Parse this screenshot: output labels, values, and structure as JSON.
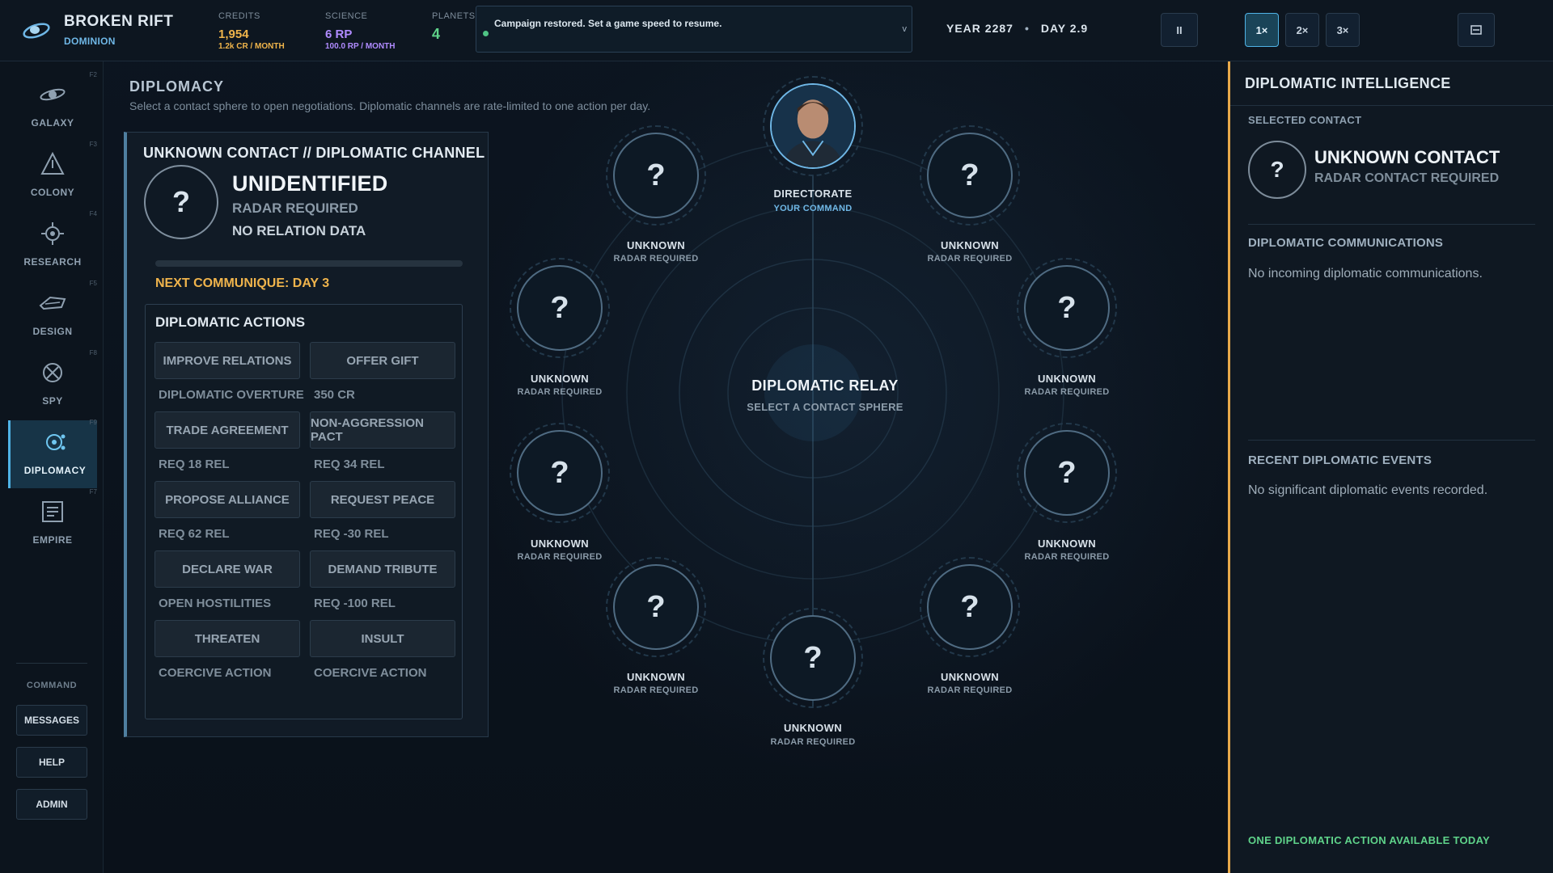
{
  "app": {
    "title": "BROKEN RIFT",
    "faction": "DOMINION"
  },
  "resources": {
    "credits": {
      "label": "CREDITS",
      "value": "1,954",
      "rate": "1.2k CR / MONTH"
    },
    "science": {
      "label": "SCIENCE",
      "value": "6 RP",
      "rate": "100.0 RP / MONTH"
    },
    "planets": {
      "label": "PLANETS",
      "value": "4"
    }
  },
  "notification": {
    "text": "Campaign restored. Set a game speed to resume.",
    "chevron": "v"
  },
  "date": {
    "year": "YEAR 2287",
    "separator": "•",
    "day": "DAY 2.9"
  },
  "controls": {
    "pause": "II",
    "speed1": "1×",
    "speed2": "2×",
    "speed3": "3×",
    "menu_icon": "menu-icon"
  },
  "sidebar": {
    "items": [
      {
        "label": "GALAXY",
        "key": "F2"
      },
      {
        "label": "COLONY",
        "key": "F3"
      },
      {
        "label": "RESEARCH",
        "key": "F4"
      },
      {
        "label": "DESIGN",
        "key": "F5"
      },
      {
        "label": "SPY",
        "key": "F8"
      },
      {
        "label": "DIPLOMACY",
        "key": "F9"
      },
      {
        "label": "EMPIRE",
        "key": "F7"
      }
    ],
    "command_label": "COMMAND",
    "buttons": [
      "MESSAGES",
      "HELP",
      "ADMIN"
    ]
  },
  "main": {
    "title": "DIPLOMACY",
    "subtitle": "Select a contact sphere to open negotiations. Diplomatic channels are rate-limited to one action per day."
  },
  "channel": {
    "title": "UNKNOWN CONTACT // DIPLOMATIC CHANNEL",
    "avatar": "?",
    "name": "UNIDENTIFIED",
    "line1": "RADAR REQUIRED",
    "line2": "NO RELATION DATA",
    "next_communique": "NEXT COMMUNIQUE: DAY 3",
    "actions_title": "DIPLOMATIC ACTIONS",
    "actions": [
      {
        "label": "IMPROVE RELATIONS",
        "req": "DIPLOMATIC OVERTURE"
      },
      {
        "label": "OFFER GIFT",
        "req": "350 CR"
      },
      {
        "label": "TRADE AGREEMENT",
        "req": "REQ 18 REL"
      },
      {
        "label": "NON-AGGRESSION PACT",
        "req": "REQ 34 REL"
      },
      {
        "label": "PROPOSE ALLIANCE",
        "req": "REQ 62 REL"
      },
      {
        "label": "REQUEST PEACE",
        "req": "REQ -30 REL"
      },
      {
        "label": "DECLARE WAR",
        "req": "OPEN HOSTILITIES"
      },
      {
        "label": "DEMAND TRIBUTE",
        "req": "REQ -100 REL"
      },
      {
        "label": "THREATEN",
        "req": "COERCIVE ACTION"
      },
      {
        "label": "INSULT",
        "req": "COERCIVE ACTION"
      }
    ]
  },
  "relay": {
    "title": "DIPLOMATIC RELAY",
    "subtitle": "SELECT A CONTACT SPHERE",
    "home": {
      "name": "DIRECTORATE",
      "sub": "YOUR COMMAND"
    },
    "contacts": [
      {
        "name": "UNKNOWN",
        "req": "RADAR REQUIRED",
        "glyph": "?"
      },
      {
        "name": "UNKNOWN",
        "req": "RADAR REQUIRED",
        "glyph": "?"
      },
      {
        "name": "UNKNOWN",
        "req": "RADAR REQUIRED",
        "glyph": "?"
      },
      {
        "name": "UNKNOWN",
        "req": "RADAR REQUIRED",
        "glyph": "?"
      },
      {
        "name": "UNKNOWN",
        "req": "RADAR REQUIRED",
        "glyph": "?"
      },
      {
        "name": "UNKNOWN",
        "req": "RADAR REQUIRED",
        "glyph": "?"
      },
      {
        "name": "UNKNOWN",
        "req": "RADAR REQUIRED",
        "glyph": "?"
      },
      {
        "name": "UNKNOWN",
        "req": "RADAR REQUIRED",
        "glyph": "?"
      },
      {
        "name": "UNKNOWN",
        "req": "RADAR REQUIRED",
        "glyph": "?"
      }
    ]
  },
  "intel": {
    "title": "DIPLOMATIC INTELLIGENCE",
    "selected_label": "SELECTED CONTACT",
    "selected_avatar": "?",
    "selected_name": "UNKNOWN CONTACT",
    "selected_sub": "RADAR CONTACT REQUIRED",
    "comms_title": "DIPLOMATIC COMMUNICATIONS",
    "comms_text": "No incoming diplomatic communications.",
    "events_title": "RECENT DIPLOMATIC EVENTS",
    "events_text": "No significant diplomatic events recorded.",
    "footer": "ONE DIPLOMATIC ACTION AVAILABLE TODAY"
  },
  "colors": {
    "accent": "#4fb3e6",
    "credits": "#f0b54b",
    "science": "#b08bff",
    "planets": "#5fd38a",
    "warning": "#f0b44c",
    "panel_edge": "#e8a94a"
  }
}
